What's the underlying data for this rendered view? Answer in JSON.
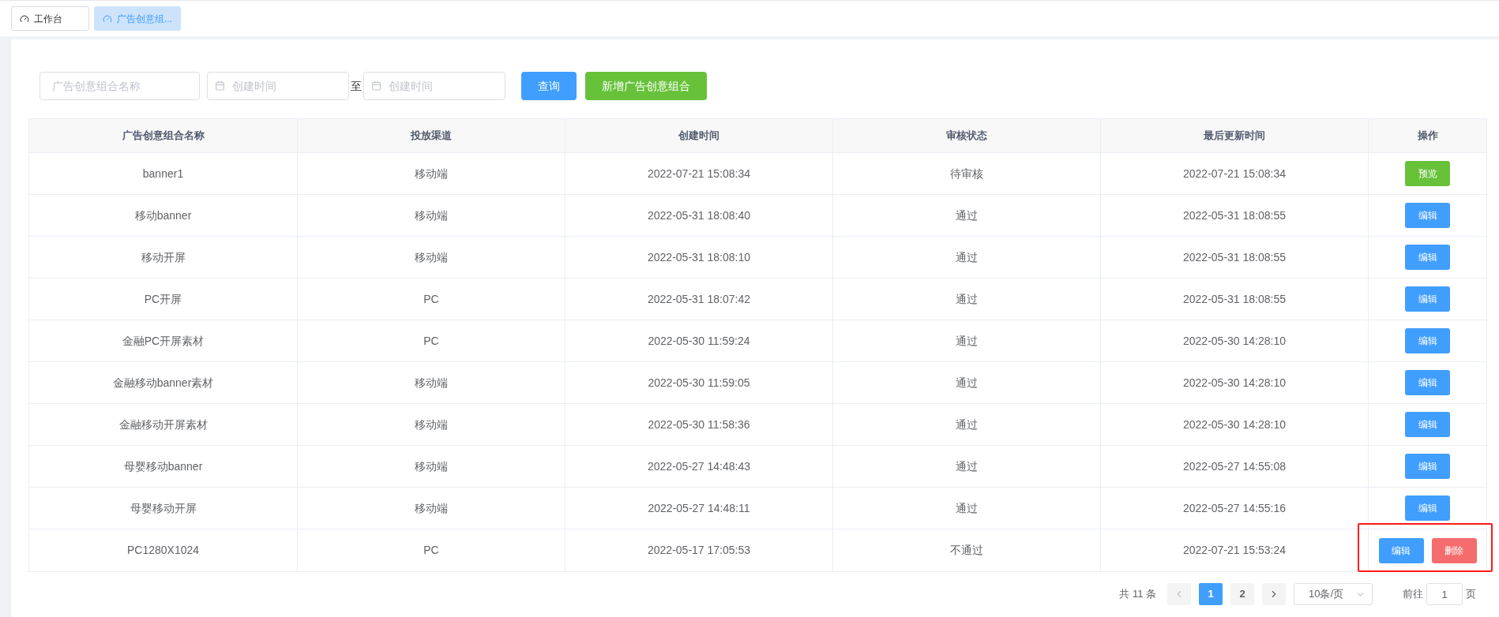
{
  "tabs": [
    {
      "label": "工作台",
      "selected": false
    },
    {
      "label": "广告创意组...",
      "selected": true
    }
  ],
  "filters": {
    "name_placeholder": "广告创意组合名称",
    "start_placeholder": "创建时间",
    "separator": "至",
    "end_placeholder": "创建时间",
    "search_button": "查询",
    "add_button": "新增广告创意组合"
  },
  "table": {
    "columns": [
      "广告创意组合名称",
      "投放渠道",
      "创建时间",
      "审核状态",
      "最后更新时间",
      "操作"
    ],
    "rows": [
      {
        "cells": [
          "banner1",
          "移动端",
          "2022-07-21 15:08:34",
          "待审核",
          "2022-07-21 15:08:34"
        ],
        "highlighted": false,
        "actions": [
          {
            "label": "预览",
            "kind": "preview"
          }
        ]
      },
      {
        "cells": [
          "移动banner",
          "移动端",
          "2022-05-31 18:08:40",
          "通过",
          "2022-05-31 18:08:55"
        ],
        "highlighted": false,
        "actions": [
          {
            "label": "编辑",
            "kind": "edit"
          }
        ]
      },
      {
        "cells": [
          "移动开屏",
          "移动端",
          "2022-05-31 18:08:10",
          "通过",
          "2022-05-31 18:08:55"
        ],
        "highlighted": false,
        "actions": [
          {
            "label": "编辑",
            "kind": "edit"
          }
        ]
      },
      {
        "cells": [
          "PC开屏",
          "PC",
          "2022-05-31 18:07:42",
          "通过",
          "2022-05-31 18:08:55"
        ],
        "highlighted": false,
        "actions": [
          {
            "label": "编辑",
            "kind": "edit"
          }
        ]
      },
      {
        "cells": [
          "金融PC开屏素材",
          "PC",
          "2022-05-30 11:59:24",
          "通过",
          "2022-05-30 14:28:10"
        ],
        "highlighted": false,
        "actions": [
          {
            "label": "编辑",
            "kind": "edit"
          }
        ]
      },
      {
        "cells": [
          "金融移动banner素材",
          "移动端",
          "2022-05-30 11:59:05",
          "通过",
          "2022-05-30 14:28:10"
        ],
        "highlighted": false,
        "actions": [
          {
            "label": "编辑",
            "kind": "edit"
          }
        ]
      },
      {
        "cells": [
          "金融移动开屏素材",
          "移动端",
          "2022-05-30 11:58:36",
          "通过",
          "2022-05-30 14:28:10"
        ],
        "highlighted": false,
        "actions": [
          {
            "label": "编辑",
            "kind": "edit"
          }
        ]
      },
      {
        "cells": [
          "母婴移动banner",
          "移动端",
          "2022-05-27 14:48:43",
          "通过",
          "2022-05-27 14:55:08"
        ],
        "highlighted": false,
        "actions": [
          {
            "label": "编辑",
            "kind": "edit"
          }
        ]
      },
      {
        "cells": [
          "母婴移动开屏",
          "移动端",
          "2022-05-27 14:48:11",
          "通过",
          "2022-05-27 14:55:16"
        ],
        "highlighted": false,
        "actions": [
          {
            "label": "编辑",
            "kind": "edit"
          }
        ]
      },
      {
        "cells": [
          "PC1280X1024",
          "PC",
          "2022-05-17 17:05:53",
          "不通过",
          "2022-07-21 15:53:24"
        ],
        "highlighted": true,
        "actions": [
          {
            "label": "编辑",
            "kind": "edit"
          },
          {
            "label": "删除",
            "kind": "delete"
          }
        ]
      }
    ]
  },
  "pagination": {
    "total": "共 11 条",
    "pages": [
      {
        "label": "1",
        "selected": true
      },
      {
        "label": "2",
        "selected": false
      }
    ],
    "page_size": "10条/页",
    "goto_label": "前往",
    "goto_value": "1",
    "goto_suffix": "页"
  }
}
